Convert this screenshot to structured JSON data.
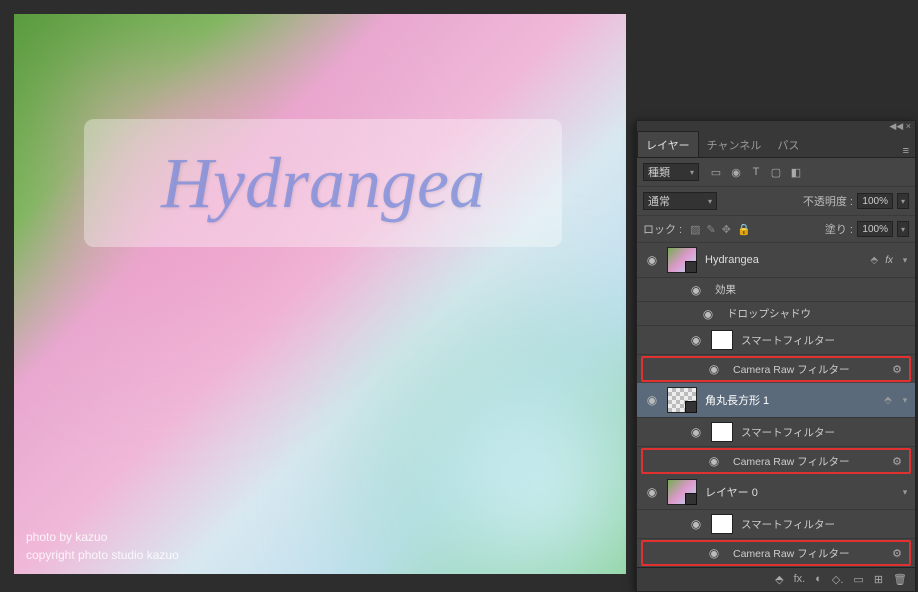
{
  "canvas": {
    "title_text": "Hydrangea",
    "credit_line1": "photo by kazuo",
    "credit_line2": "copyright photo studio kazuo"
  },
  "panel": {
    "collapse_hint": "◀◀  ×",
    "tabs": [
      "レイヤー",
      "チャンネル",
      "パス"
    ],
    "active_tab": 0,
    "filter_row": {
      "kind_label": "種類",
      "icons": [
        "▭",
        "◉",
        "T",
        "▢",
        "◧"
      ]
    },
    "blend_row": {
      "mode": "通常",
      "opacity_label": "不透明度 :",
      "opacity_value": "100%"
    },
    "lock_row": {
      "lock_label": "ロック :",
      "fill_label": "塗り :",
      "fill_value": "100%"
    },
    "layers": [
      {
        "name": "Hydrangea",
        "has_fx": true,
        "effects_label": "効果",
        "effects": [
          "ドロップシャドウ"
        ],
        "smart_filters_label": "スマートフィルター",
        "filters": [
          "Camera Raw フィルター"
        ]
      },
      {
        "name": "角丸長方形 1",
        "smart_filters_label": "スマートフィルター",
        "filters": [
          "Camera Raw フィルター"
        ]
      },
      {
        "name": "レイヤー 0",
        "smart_filters_label": "スマートフィルター",
        "filters": [
          "Camera Raw フィルター"
        ]
      }
    ],
    "footer_icons": [
      "⬘",
      "fx.",
      "◐",
      "◇.",
      "▭",
      "⊞",
      "🗑"
    ]
  }
}
